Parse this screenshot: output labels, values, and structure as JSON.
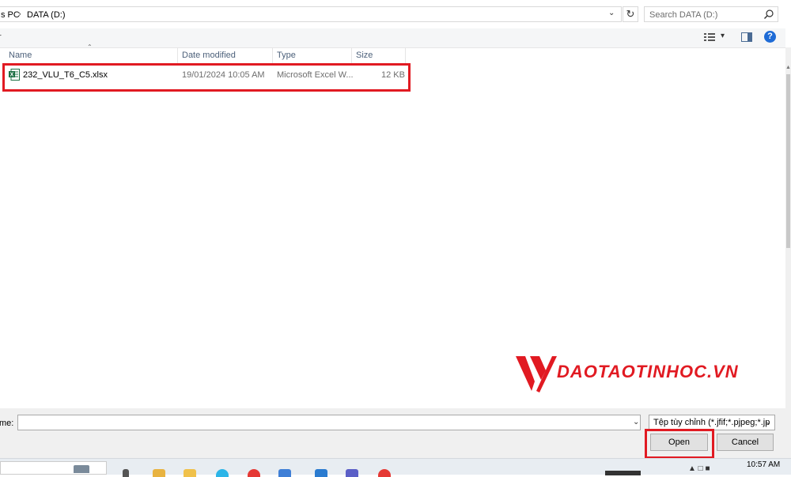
{
  "address_bar": {
    "breadcrumbs": [
      "s PC",
      "DATA (D:)"
    ],
    "separator": "›",
    "search_placeholder": "Search DATA (D:)"
  },
  "toolbar": {
    "left_label": "r"
  },
  "columns": {
    "name": "Name",
    "date_modified": "Date modified",
    "type": "Type",
    "size": "Size"
  },
  "files": [
    {
      "name": "232_VLU_T6_C5.xlsx",
      "date_modified": "19/01/2024 10:05 AM",
      "type": "Microsoft Excel W...",
      "size": "12 KB",
      "icon": "excel-file-icon"
    }
  ],
  "watermark": {
    "text": "DAOTAOTINHOC.VN"
  },
  "bottom": {
    "file_name_label": "me:",
    "file_name_value": "",
    "file_type_filter": "Tệp tùy chỉnh (*.jfif;*.pjpeg;*.jp",
    "open_label": "Open",
    "cancel_label": "Cancel"
  },
  "taskbar": {
    "clock": "10:57 AM"
  },
  "colors": {
    "highlight": "#e11a22",
    "excel_green": "#1d7044",
    "help_blue": "#1e6bd6"
  }
}
